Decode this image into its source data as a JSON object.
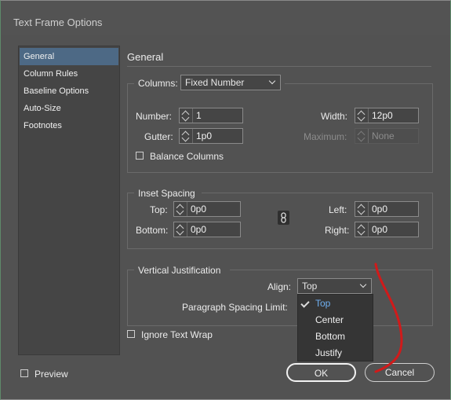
{
  "window": {
    "title": "Text Frame Options"
  },
  "sidebar": {
    "items": [
      {
        "label": "General",
        "selected": true
      },
      {
        "label": "Column Rules"
      },
      {
        "label": "Baseline Options"
      },
      {
        "label": "Auto-Size"
      },
      {
        "label": "Footnotes"
      }
    ]
  },
  "general": {
    "heading": "General",
    "columns": {
      "label": "Columns:",
      "type": "Fixed Number",
      "number_label": "Number:",
      "number": "1",
      "width_label": "Width:",
      "width": "12p0",
      "gutter_label": "Gutter:",
      "gutter": "1p0",
      "maximum_label": "Maximum:",
      "maximum": "None",
      "balance_label": "Balance Columns"
    },
    "inset": {
      "title": "Inset Spacing",
      "top_label": "Top:",
      "top": "0p0",
      "bottom_label": "Bottom:",
      "bottom": "0p0",
      "left_label": "Left:",
      "left": "0p0",
      "right_label": "Right:",
      "right": "0p0"
    },
    "vertical": {
      "title": "Vertical Justification",
      "align_label": "Align:",
      "align": "Top",
      "para_label": "Paragraph Spacing Limit:",
      "options": [
        "Top",
        "Center",
        "Bottom",
        "Justify"
      ]
    },
    "ignore_wrap_label": "Ignore Text Wrap"
  },
  "footer": {
    "preview_label": "Preview",
    "ok_label": "OK",
    "cancel_label": "Cancel"
  },
  "colors": {
    "selection": "#4d6985",
    "menu_selected": "#6fb0f2",
    "annotation": "#d11a1a"
  }
}
